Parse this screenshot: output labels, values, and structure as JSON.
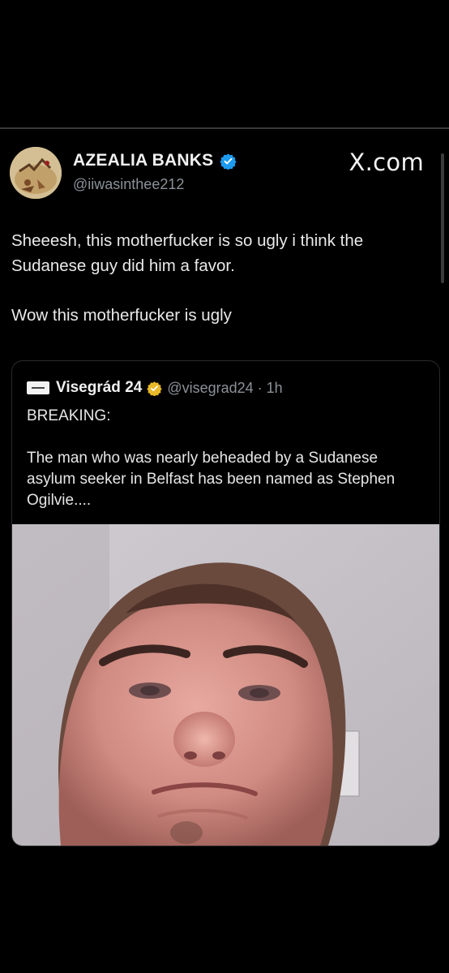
{
  "tweet": {
    "display_name": "AZEALIA BANKS",
    "handle": "@iiwasinthee212",
    "brand": "X.com",
    "verified_icon": "verified-badge-icon",
    "verified_color": "#1d9bf0",
    "paragraphs": [
      "Sheeesh, this motherfucker is so ugly i think the Sudanese guy did him a favor.",
      "Wow this motherfucker is ugly"
    ]
  },
  "quote": {
    "name": "Visegrád 24",
    "handle_time": "@visegrad24 · 1h",
    "badge_icon": "gold-verified-badge-icon",
    "badge_color": "#e8b829",
    "paragraphs": [
      "BREAKING:",
      "The man who was nearly beheaded by a Sudanese asylum seeker in Belfast has been named as Stephen Ogilvie...."
    ],
    "image": "man-selfie-photo"
  },
  "colors": {
    "background": "#000000",
    "text": "#e7e9ea",
    "muted": "#8b9198"
  }
}
